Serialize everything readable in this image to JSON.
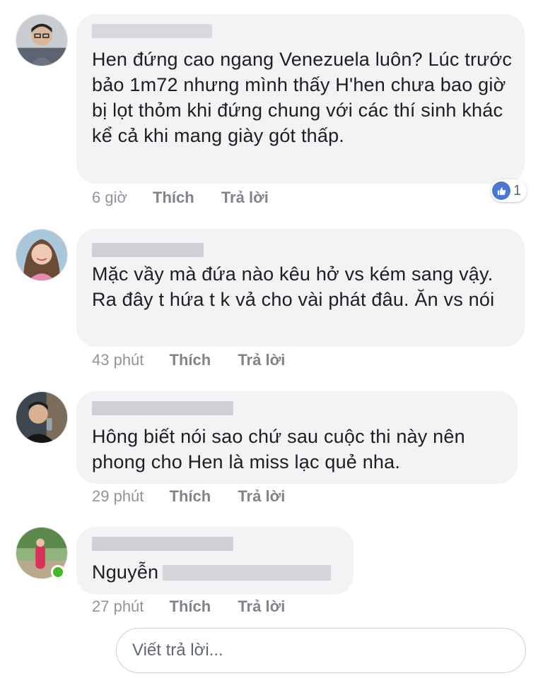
{
  "comments": [
    {
      "text": "Hen đứng cao ngang Venezuela luôn? Lúc trước bảo 1m72 nhưng mình thấy H'hen chưa bao giờ bị lọt thỏm khi đứng chung với các thí sinh khác kể cả khi mang giày gót thấp.",
      "time": "6 giờ",
      "like_label": "Thích",
      "reply_label": "Trả lời",
      "reaction_count": "1",
      "reaction_icon": "thumbs-up-icon"
    },
    {
      "text": "Mặc vầy mà đứa nào kêu hở vs kém sang vậy. Ra đây t hứa t k vả cho vài phát đâu. Ăn vs nói",
      "time": "43 phút",
      "like_label": "Thích",
      "reply_label": "Trả lời"
    },
    {
      "text": "Hông biết nói sao chứ sau cuộc thi này nên phong cho Hen là miss lạc quẻ nha.",
      "time": "29 phút",
      "like_label": "Thích",
      "reply_label": "Trả lời"
    },
    {
      "text": "Nguyễn",
      "time": "27 phút",
      "like_label": "Thích",
      "reply_label": "Trả lời",
      "online": true
    }
  ],
  "reply_box": {
    "placeholder": "Viết trả lời..."
  },
  "colors": {
    "bubble": "#f2f3f5",
    "text": "#1c1e21",
    "meta": "#90949c",
    "like_blue": "#4a77d4",
    "online_green": "#42b72a"
  }
}
